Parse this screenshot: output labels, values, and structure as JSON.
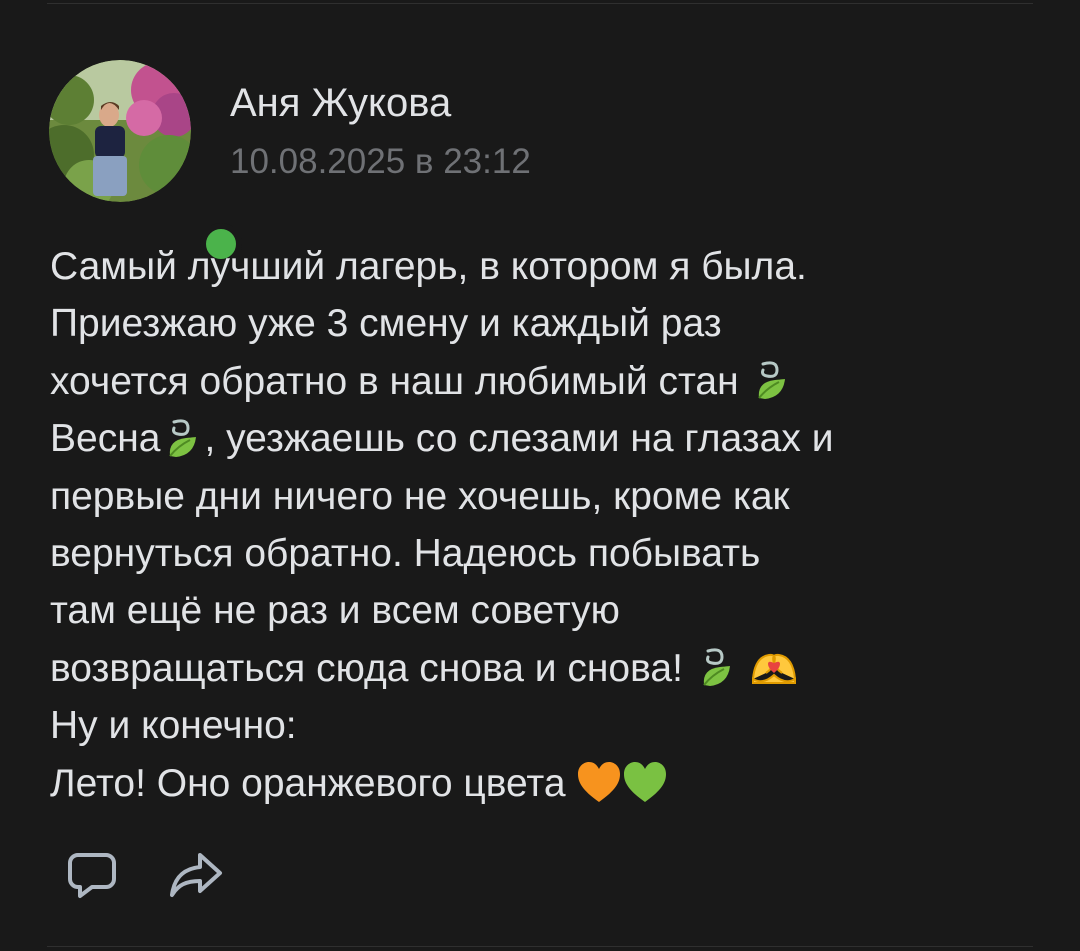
{
  "post": {
    "author": "Аня Жукова",
    "timestamp": "10.08.2025 в 23:12",
    "online": true,
    "lines": {
      "l1": "Самый лучший лагерь, в котором я была.",
      "l2": "Приезжаю уже 3 смену и каждый раз",
      "l3": "хочется обратно в наш любимый стан",
      "l4a": "Весна",
      "l4b": ", уезжаешь со слезами на глазах и",
      "l5": "первые дни ничего не хочешь, кроме как",
      "l6": "вернуться обратно. Надеюсь побывать",
      "l7": "там ещё не раз и всем советую",
      "l8": "возвращаться сюда снова и снова!",
      "l9": "Ну и конечно:",
      "l10": "Лето! Оно оранжевого цвета"
    },
    "emoji": {
      "leaf": "leaf-fluttering-in-wind-emoji",
      "heart_hands": "heart-hands-emoji",
      "orange_heart": "orange-heart-emoji",
      "green_heart": "green-heart-emoji"
    }
  },
  "actions": {
    "comment_icon": "comment-icon",
    "share_icon": "share-icon"
  },
  "colors": {
    "background": "#191919",
    "text": "#e1e3e6",
    "secondary_text": "#6f7175",
    "online": "#4bb34b",
    "icon": "#aeb7c2"
  }
}
